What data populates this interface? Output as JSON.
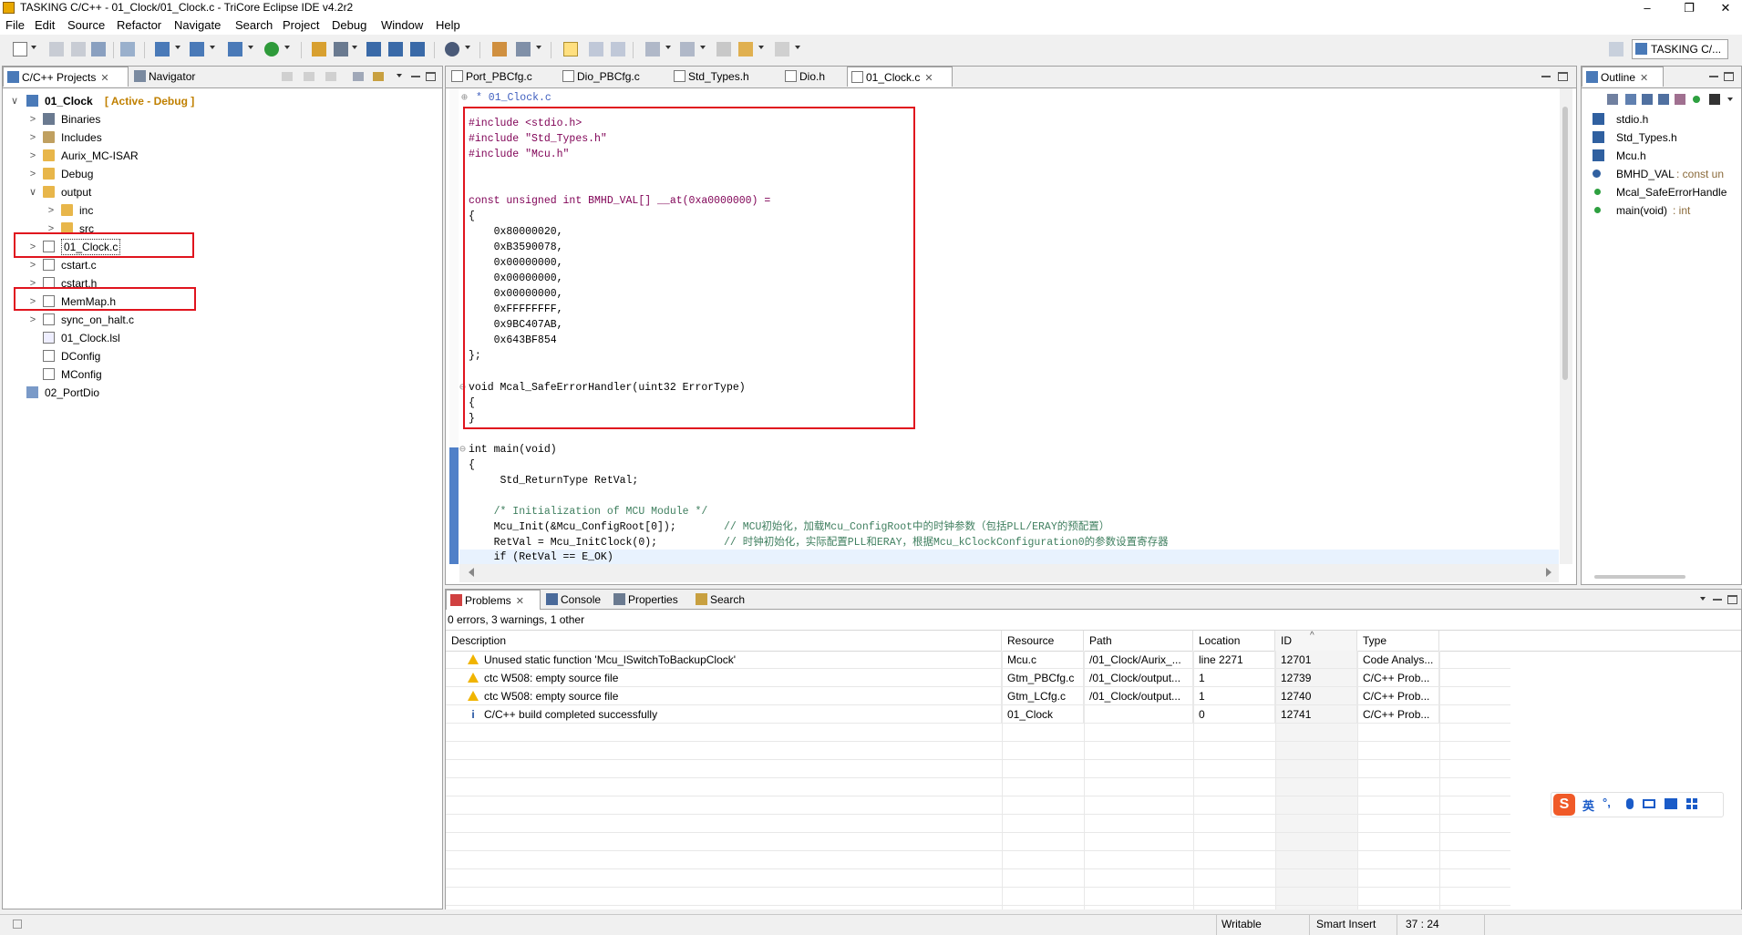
{
  "window": {
    "title": "TASKING C/C++ - 01_Clock/01_Clock.c - TriCore Eclipse IDE v4.2r2",
    "minimize": "–",
    "maximize": "❐",
    "close": "✕"
  },
  "menu": [
    "File",
    "Edit",
    "Source",
    "Refactor",
    "Navigate",
    "Search",
    "Project",
    "Debug",
    "Window",
    "Help"
  ],
  "perspective": {
    "label": "TASKING C/..."
  },
  "left_panel": {
    "tabs": [
      {
        "label": "C/C++ Projects",
        "close": "✕"
      },
      {
        "label": "Navigator"
      }
    ],
    "tree": [
      {
        "label": "01_Clock",
        "suffix": "[ Active - Debug ]",
        "twisty": "∨",
        "icon": "project-icon"
      },
      {
        "label": "Binaries",
        "twisty": ">",
        "icon": "binaries-icon"
      },
      {
        "label": "Includes",
        "twisty": ">",
        "icon": "includes-icon"
      },
      {
        "label": "Aurix_MC-ISAR",
        "twisty": ">",
        "icon": "folder-icon"
      },
      {
        "label": "Debug",
        "twisty": ">",
        "icon": "folder-icon"
      },
      {
        "label": "output",
        "twisty": "∨",
        "icon": "folder-icon"
      },
      {
        "label": "inc",
        "twisty": ">",
        "icon": "folder-icon"
      },
      {
        "label": "src",
        "twisty": ">",
        "icon": "folder-icon"
      },
      {
        "label": "01_Clock.c",
        "twisty": ">",
        "icon": "c-file-icon"
      },
      {
        "label": "cstart.c",
        "twisty": ">",
        "icon": "c-file-icon"
      },
      {
        "label": "cstart.h",
        "twisty": ">",
        "icon": "h-file-icon"
      },
      {
        "label": "MemMap.h",
        "twisty": ">",
        "icon": "h-file-icon"
      },
      {
        "label": "sync_on_halt.c",
        "twisty": ">",
        "icon": "c-file-icon"
      },
      {
        "label": "01_Clock.lsl",
        "twisty": "",
        "icon": "lsl-file-icon"
      },
      {
        "label": "DConfig",
        "twisty": "",
        "icon": "file-icon"
      },
      {
        "label": "MConfig",
        "twisty": "",
        "icon": "file-icon"
      },
      {
        "label": "02_PortDio",
        "twisty": "",
        "icon": "project-closed-icon"
      }
    ]
  },
  "editor": {
    "tabs": [
      {
        "label": "Port_PBCfg.c"
      },
      {
        "label": "Dio_PBCfg.c"
      },
      {
        "label": "Std_Types.h"
      },
      {
        "label": "Dio.h"
      },
      {
        "label": "01_Clock.c",
        "close": "✕"
      }
    ],
    "lines": [
      "* 01_Clock.c",
      "#include <stdio.h>",
      "#include \"Std_Types.h\"",
      "#include \"Mcu.h\"",
      "const unsigned int BMHD_VAL[] __at(0xa0000000) =",
      "{",
      "    0x80000020,",
      "    0xB3590078,",
      "    0x00000000,",
      "    0x00000000,",
      "    0x00000000,",
      "    0xFFFFFFFF,",
      "    0x9BC407AB,",
      "    0x643BF854",
      "};",
      "void Mcal_SafeErrorHandler(uint32 ErrorType)",
      "{",
      "}",
      "int main(void)",
      "{",
      "     Std_ReturnType RetVal;",
      "    /* Initialization of MCU Module */",
      "    Mcu_Init(&Mcu_ConfigRoot[0]);",
      "// MCU初始化，加载Mcu_ConfigRoot中的时钟参数（包括PLL/ERAY的预配置）",
      "    RetVal = Mcu_InitClock(0);",
      "// 时钟初始化，实际配置PLL和ERAY，根据Mcu_kClockConfiguration0的参数设置寄存器",
      "    if (RetVal == E_OK)"
    ]
  },
  "outline": {
    "tab": "Outline",
    "close": "✕",
    "items": [
      {
        "label": "stdio.h",
        "type": ""
      },
      {
        "label": "Std_Types.h",
        "type": ""
      },
      {
        "label": "Mcu.h",
        "type": ""
      },
      {
        "label": "BMHD_VAL",
        "type": " : const un"
      },
      {
        "label": "Mcal_SafeErrorHandle",
        "type": ""
      },
      {
        "label": "main(void)",
        "type": " : int"
      }
    ]
  },
  "bottom": {
    "tabs": [
      {
        "label": "Problems",
        "close": "✕"
      },
      {
        "label": "Console"
      },
      {
        "label": "Properties"
      },
      {
        "label": "Search"
      }
    ],
    "summary": "0 errors, 3 warnings, 1 other",
    "columns": [
      "Description",
      "Resource",
      "Path",
      "Location",
      "ID",
      "Type"
    ],
    "rows": [
      {
        "kind": "warning",
        "desc": "Unused static function 'Mcu_lSwitchToBackupClock'",
        "resource": "Mcu.c",
        "path": "/01_Clock/Aurix_...",
        "location": "line 2271",
        "id": "12701",
        "type": "Code Analys..."
      },
      {
        "kind": "warning",
        "desc": "ctc W508: empty source file",
        "resource": "Gtm_PBCfg.c",
        "path": "/01_Clock/output...",
        "location": "1",
        "id": "12739",
        "type": "C/C++ Prob..."
      },
      {
        "kind": "warning",
        "desc": "ctc W508: empty source file",
        "resource": "Gtm_LCfg.c",
        "path": "/01_Clock/output...",
        "location": "1",
        "id": "12740",
        "type": "C/C++ Prob..."
      },
      {
        "kind": "info",
        "desc": "C/C++ build completed successfully",
        "resource": "01_Clock",
        "path": "",
        "location": "0",
        "id": "12741",
        "type": "C/C++ Prob..."
      }
    ]
  },
  "status": {
    "writable": "Writable",
    "insert": "Smart Insert",
    "position": "37 : 24"
  },
  "ime": {
    "lang": "英",
    "punct": "°,"
  }
}
